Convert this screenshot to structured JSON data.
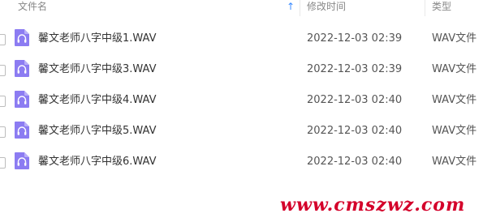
{
  "header": {
    "col_name": "文件名",
    "col_modified": "修改时间",
    "col_type": "类型",
    "sort_direction": "ascending"
  },
  "files": [
    {
      "name": "馨文老师八字中级1.WAV",
      "modified": "2022-12-03 02:39",
      "type": "WAV文件",
      "icon": "audio-file-icon"
    },
    {
      "name": "馨文老师八字中级3.WAV",
      "modified": "2022-12-03 02:39",
      "type": "WAV文件",
      "icon": "audio-file-icon"
    },
    {
      "name": "馨文老师八字中级4.WAV",
      "modified": "2022-12-03 02:40",
      "type": "WAV文件",
      "icon": "audio-file-icon"
    },
    {
      "name": "馨文老师八字中级5.WAV",
      "modified": "2022-12-03 02:40",
      "type": "WAV文件",
      "icon": "audio-file-icon"
    },
    {
      "name": "馨文老师八字中级6.WAV",
      "modified": "2022-12-03 02:40",
      "type": "WAV文件",
      "icon": "audio-file-icon"
    }
  ],
  "watermark": "www.cmszwz.com",
  "colors": {
    "icon_purple": "#8c7cf2",
    "sort_arrow": "#3b8cff",
    "watermark_red": "#d4002a"
  }
}
